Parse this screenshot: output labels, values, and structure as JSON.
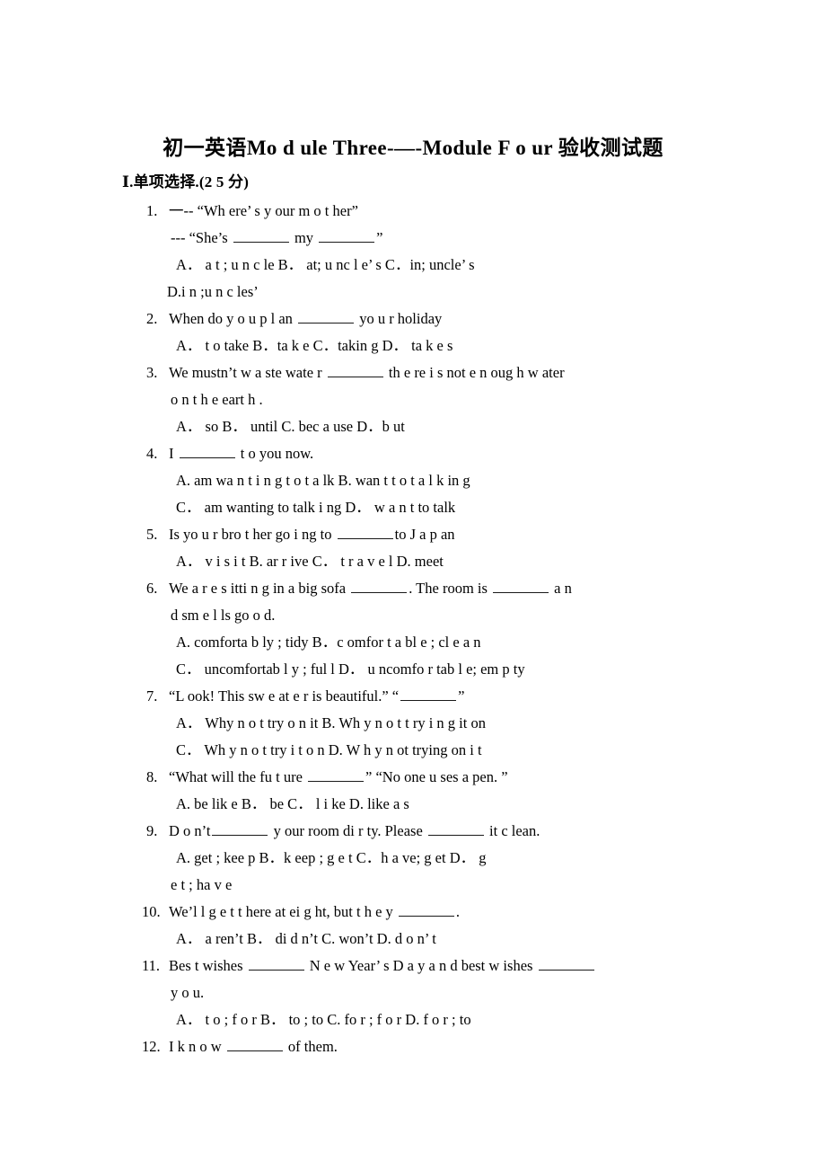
{
  "document": {
    "title": "初一英语Mo d ule Three-—-Module F o ur  验收测试题",
    "section_header": "Ⅰ.单项选择.(2 5 分)"
  },
  "questions": [
    {
      "number": "1.",
      "lines": [
        {
          "indent": "body",
          "text": "一-- “Wh ere’ s   y our  m o  t her”"
        },
        {
          "indent": "cont",
          "text": "--- “She’s ______ my ______”"
        },
        {
          "indent": "opt",
          "text": "A．  a t  ;   u n c le          B．  at;   u nc l e’ s            C．in;   uncle’ s"
        },
        {
          "indent": "cont2",
          "text": "D.i n   ;u n c les’"
        }
      ]
    },
    {
      "number": "2.",
      "lines": [
        {
          "indent": "body",
          "text": "When do   y o u    p l an ______  yo u  r    holiday"
        },
        {
          "indent": "opt",
          "text": "A． t o   take       B．ta k e       C．takin g          D．  ta k e s"
        }
      ]
    },
    {
      "number": "3.",
      "lines": [
        {
          "indent": "body",
          "text": "We mustn’t   w a ste   wate r   ______     th e re    i  s   not e n oug h   w ater"
        },
        {
          "indent": "cont",
          "text": "o n t h e eart h ."
        },
        {
          "indent": "opt",
          "text": "A．   so     B．  until      C. bec a use        D．b ut"
        }
      ]
    },
    {
      "number": "4.",
      "lines": [
        {
          "indent": "body",
          "text": "I   ______    t o  you   now."
        },
        {
          "indent": "opt",
          "text": "A. am wa n t i n g  t o  t a lk        B.  wan t   t o    t a l k in g"
        },
        {
          "indent": "opt",
          "text": "C．  am   wanting to talk i ng        D．  w a n t  to   talk"
        }
      ]
    },
    {
      "number": "5.",
      "lines": [
        {
          "indent": "body",
          "text": "Is yo u r   bro t her go i ng to ______to   J a p an"
        },
        {
          "indent": "opt",
          "text": "A．  v i s i t    B. ar r ive      C．  t r a v e l     D. meet"
        }
      ]
    },
    {
      "number": "6.",
      "lines": [
        {
          "indent": "body",
          "text": "We   a r e   s itti n g  in a big sofa ______.   The room is ______ a n"
        },
        {
          "indent": "cont",
          "text": "d   sm e  l ls go o d."
        },
        {
          "indent": "opt",
          "text": "A. comforta b ly ;   tidy       B．c omfor t a bl e  ;    cl e a n"
        },
        {
          "indent": "opt",
          "text": "C．   uncomfortab l  y  ; ful l         D．   u ncomfo r tab l e;  em p ty"
        }
      ]
    },
    {
      "number": "7.",
      "lines": [
        {
          "indent": "body",
          "text": "“L ook! This sw e at e r is   beautiful.”  “______”"
        },
        {
          "indent": "opt",
          "text": "A．   Why n o t try  o n  it     B. Wh y  n o t  t ry i n g   it on"
        },
        {
          "indent": "opt",
          "text": "C．  Wh y  n o  t   try i t    o n      D. W h y  n ot trying on  i  t"
        }
      ]
    },
    {
      "number": "8.",
      "lines": [
        {
          "indent": "body",
          "text": "“What will the fu t ure ______”   “No one   u ses a   pen. ”"
        },
        {
          "indent": "opt",
          "text": "A. be lik e       B．  be      C．  l i ke     D. like   a s"
        }
      ]
    },
    {
      "number": "9.",
      "lines": [
        {
          "indent": "body",
          "text": "D o n’t______   y our   room di r ty. Please     ______   it   c lean."
        },
        {
          "indent": "opt",
          "text": "A. get ;   kee p       B．k eep ;   g e t       C．h a ve;   g et    D．  g"
        },
        {
          "indent": "cont",
          "text": "e t ; ha v  e"
        }
      ]
    },
    {
      "number": "10.",
      "wide": true,
      "lines": [
        {
          "indent": "body",
          "text": "We’l l   g e t   t here at ei g ht, but t h e y   ______."
        },
        {
          "indent": "opt",
          "text": "A．  a ren’t    B．  di d n’t      C. won’t       D. d o n’ t"
        }
      ]
    },
    {
      "number": "11.",
      "wide": true,
      "lines": [
        {
          "indent": "body",
          "text": "Bes t   wishes ______   N e w  Year’ s   D a y  a n d best  w ishes ______"
        },
        {
          "indent": "cont",
          "text": "y o u."
        },
        {
          "indent": "opt",
          "text": "A．  t o  ; f o r     B．  to ;   to     C. fo r  ; f o r        D. f o r  ;   to"
        }
      ]
    },
    {
      "number": "12.",
      "wide": true,
      "lines": [
        {
          "indent": "body",
          "text": "I    k n o w ______  of   them."
        }
      ]
    }
  ]
}
